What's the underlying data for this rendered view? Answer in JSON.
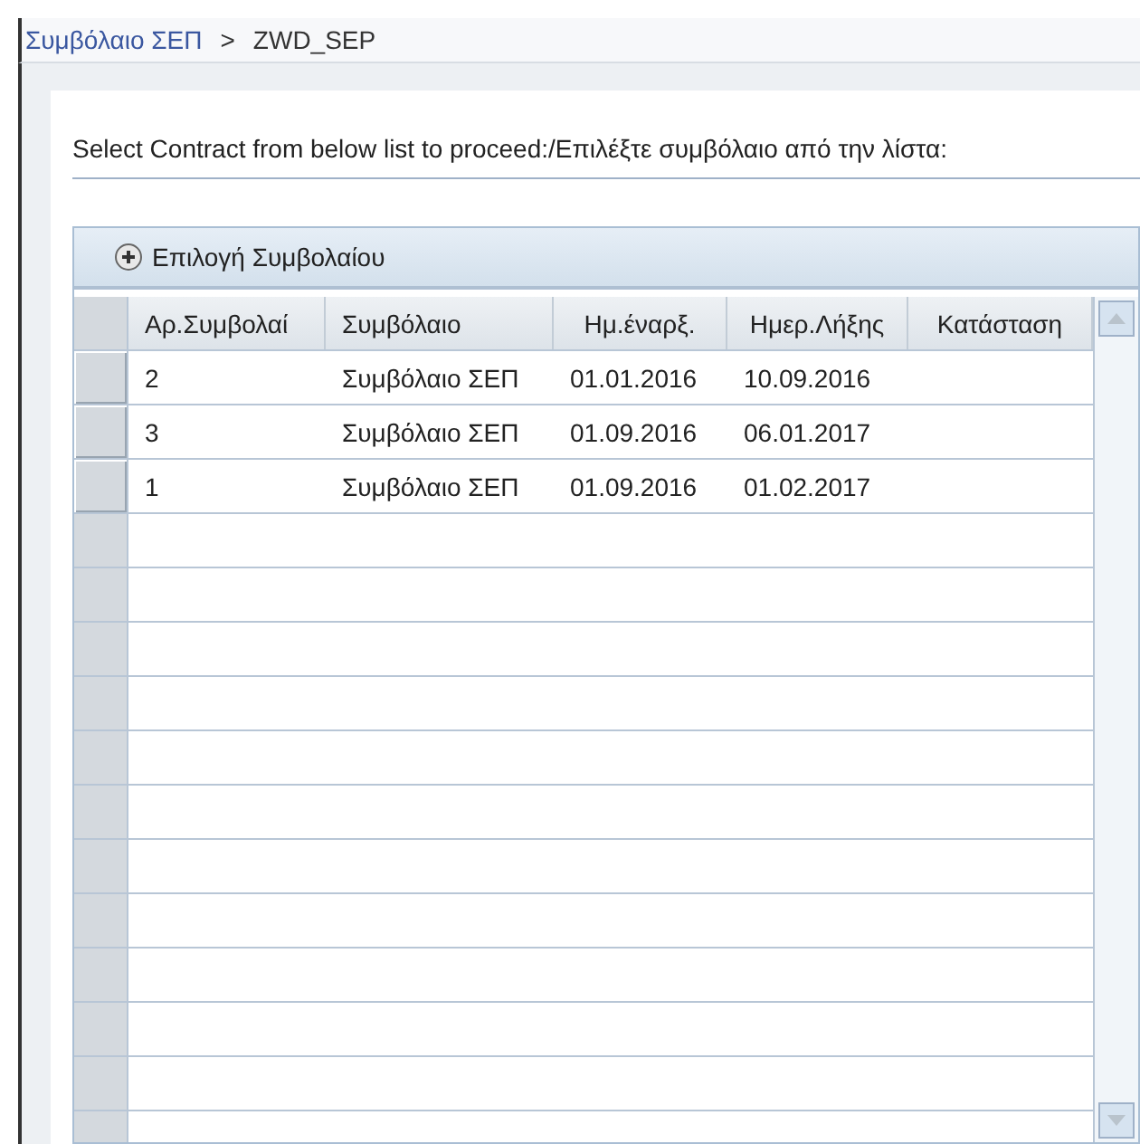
{
  "breadcrumb": {
    "link": "Συμβόλαιο ΣΕΠ",
    "separator": ">",
    "current": "ZWD_SEP"
  },
  "instruction": "Select Contract from below list to proceed:/Επιλέξτε συμβόλαιο από την λίστα:",
  "toolbar": {
    "button": "Επιλογή Συμβολαίου"
  },
  "table": {
    "columns": [
      "Αρ.Συμβολαί",
      "Συμβόλαιο",
      "Ημ.έναρξ.",
      "Ημερ.Λήξης",
      "Κατάσταση"
    ],
    "rows": [
      [
        "2",
        "Συμβόλαιο ΣΕΠ",
        "01.01.2016",
        "10.09.2016",
        ""
      ],
      [
        "3",
        "Συμβόλαιο ΣΕΠ",
        "01.09.2016",
        "06.01.2017",
        ""
      ],
      [
        "1",
        "Συμβόλαιο ΣΕΠ",
        "01.09.2016",
        "01.02.2017",
        ""
      ]
    ]
  }
}
